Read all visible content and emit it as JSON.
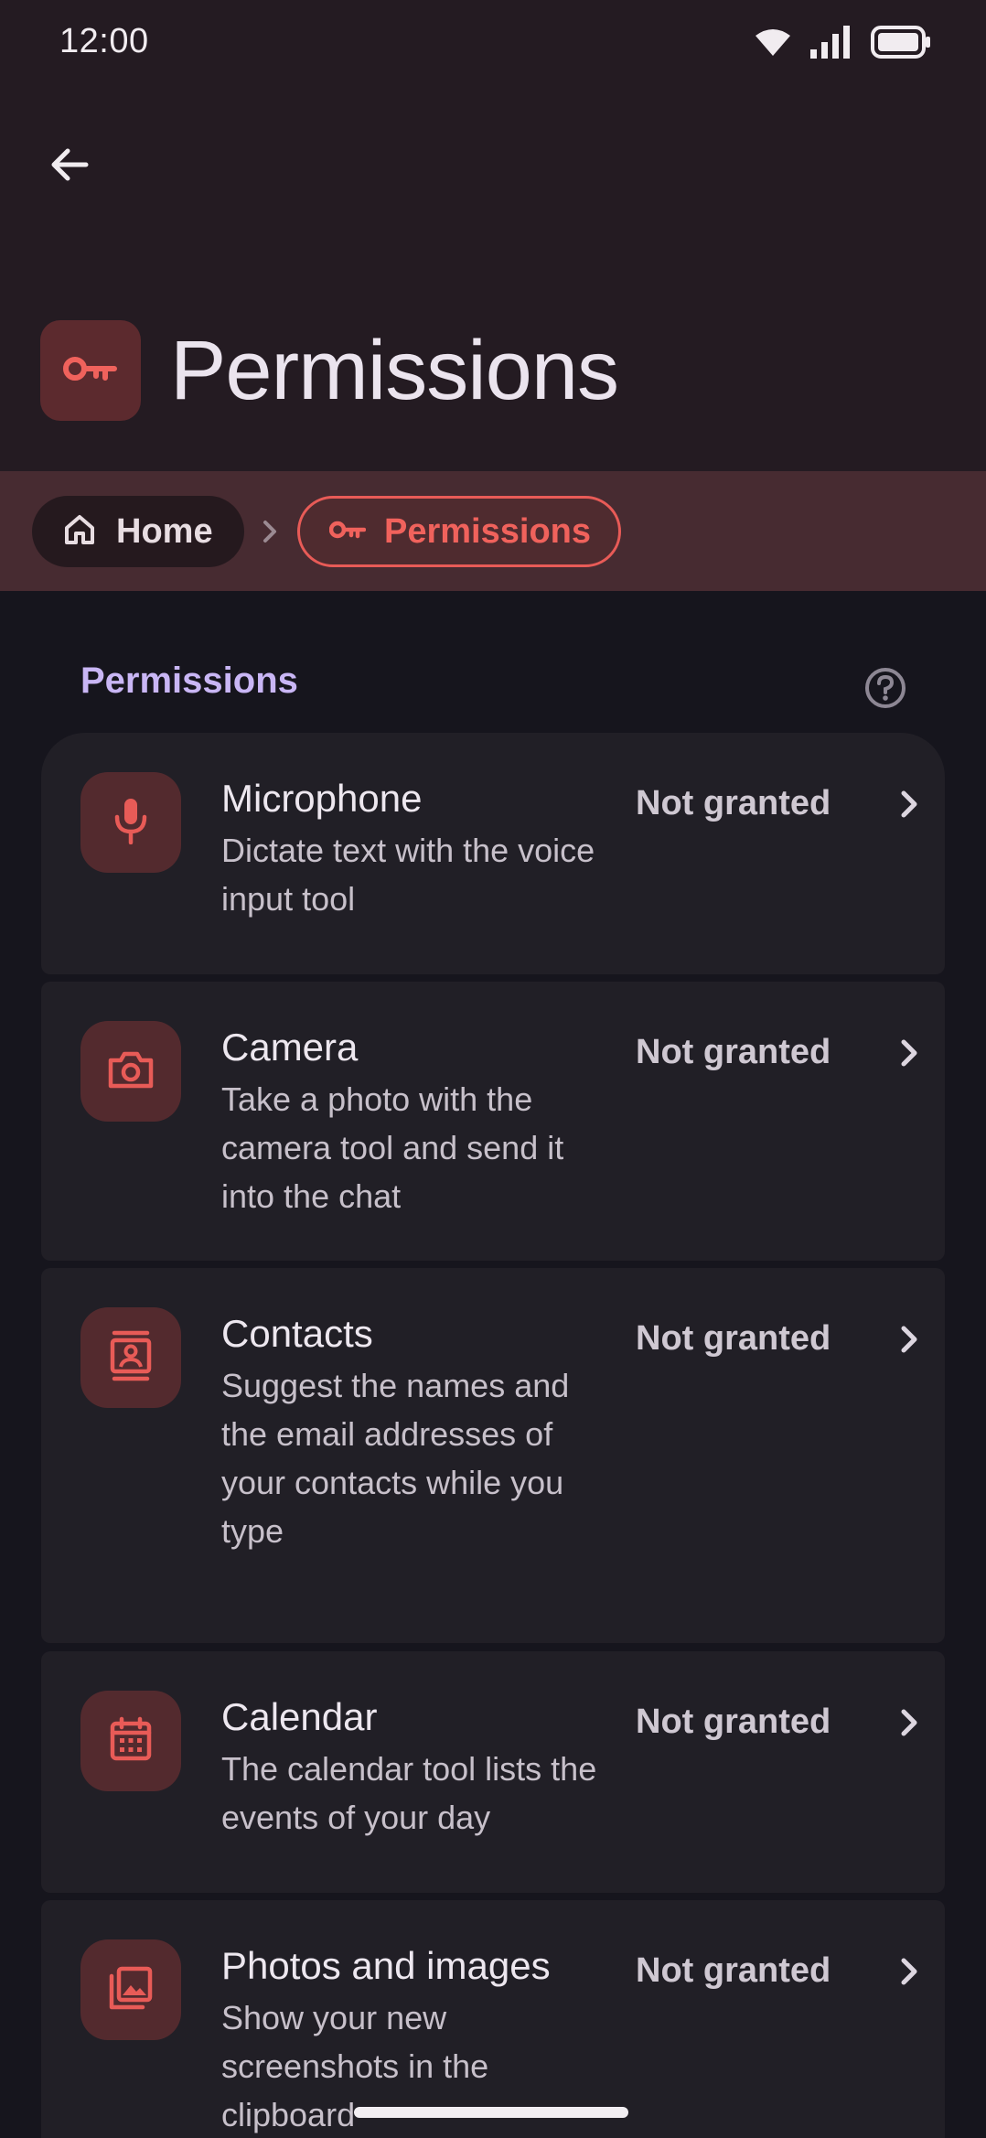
{
  "status_bar": {
    "time": "12:00",
    "icons": [
      "wifi-icon",
      "signal-icon",
      "battery-icon"
    ]
  },
  "header": {
    "back_icon": "arrow-left-icon",
    "title": "Permissions",
    "title_icon": "key-icon"
  },
  "breadcrumb": {
    "home_label": "Home",
    "home_icon": "home-icon",
    "separator_icon": "chevron-right-icon",
    "current_label": "Permissions",
    "current_icon": "key-icon"
  },
  "section": {
    "title": "Permissions",
    "help_icon": "help-circle-icon"
  },
  "permissions": [
    {
      "title": "Microphone",
      "description": "Dictate text with the voice input tool",
      "status": "Not granted",
      "icon": "microphone-icon"
    },
    {
      "title": "Camera",
      "description": "Take a photo with the camera tool and send it into the chat",
      "status": "Not granted",
      "icon": "camera-icon"
    },
    {
      "title": "Contacts",
      "description": "Suggest the names and the email addresses of your contacts while you type",
      "status": "Not granted",
      "icon": "contacts-icon"
    },
    {
      "title": "Calendar",
      "description": "The calendar tool lists the events of your day",
      "status": "Not granted",
      "icon": "calendar-icon"
    },
    {
      "title": "Photos and images",
      "description": "Show your new screenshots in the clipboard",
      "status": "Not granted",
      "icon": "photos-icon"
    }
  ],
  "colors": {
    "accent": "#e85b57",
    "section_title": "#c9b6f5",
    "header_bg": "#241b22",
    "breadcrumb_bg": "#472b31",
    "page_bg": "#16151d",
    "card_bg": "#211f26"
  }
}
